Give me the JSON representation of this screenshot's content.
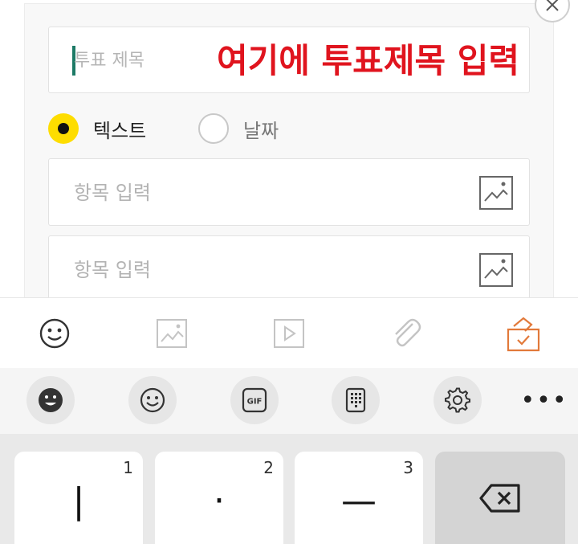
{
  "composer": {
    "title_placeholder": "투표 제목",
    "annotation": "여기에 투표제목 입력",
    "options": {
      "text_label": "텍스트",
      "text_selected": true,
      "date_label": "날짜",
      "date_selected": false
    },
    "items": [
      {
        "placeholder": "항목 입력",
        "image_icon": "image-icon"
      },
      {
        "placeholder": "항목 입력",
        "image_icon": "image-icon"
      }
    ],
    "close_icon": "close-icon"
  },
  "attach_bar": {
    "icons": [
      "emoji-icon",
      "photo-icon",
      "video-icon",
      "paperclip-icon",
      "poll-icon"
    ],
    "active_color": "#e2793a"
  },
  "keyboard": {
    "toolbar_icons": [
      "sticker-face-icon",
      "emoji-icon",
      "gif-icon",
      "keypad-icon",
      "settings-icon"
    ],
    "more_label": "•••",
    "keys": [
      {
        "num": "1",
        "sym": "|"
      },
      {
        "num": "2",
        "sym": "·"
      },
      {
        "num": "3",
        "sym": "—"
      }
    ],
    "backspace_icon": "backspace-icon"
  },
  "colors": {
    "radio_selected": "#fedd00",
    "annotation": "#e0141e",
    "caret": "#1d7a66"
  }
}
